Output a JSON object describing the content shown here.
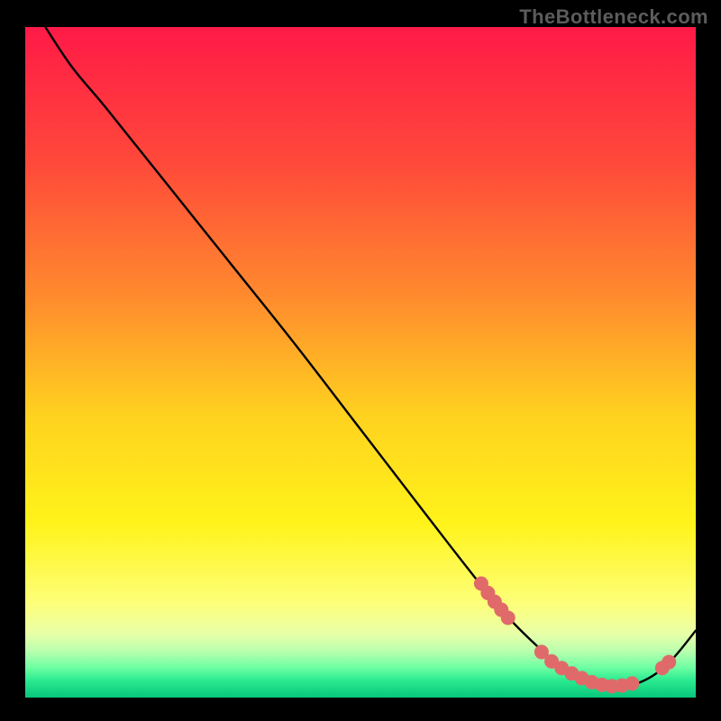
{
  "watermark": "TheBottleneck.com",
  "chart_data": {
    "type": "line",
    "title": "",
    "xlabel": "",
    "ylabel": "",
    "xlim": [
      0,
      100
    ],
    "ylim": [
      0,
      100
    ],
    "background_gradient": {
      "stops": [
        {
          "offset": 0.0,
          "color": "#ff1a47"
        },
        {
          "offset": 0.2,
          "color": "#ff483a"
        },
        {
          "offset": 0.4,
          "color": "#ff8a2e"
        },
        {
          "offset": 0.58,
          "color": "#ffd21f"
        },
        {
          "offset": 0.74,
          "color": "#fff31a"
        },
        {
          "offset": 0.86,
          "color": "#feff7a"
        },
        {
          "offset": 0.905,
          "color": "#e8ffa8"
        },
        {
          "offset": 0.93,
          "color": "#baffae"
        },
        {
          "offset": 0.955,
          "color": "#6fffa3"
        },
        {
          "offset": 0.975,
          "color": "#29e98f"
        },
        {
          "offset": 1.0,
          "color": "#08c67b"
        }
      ]
    },
    "series": [
      {
        "name": "curve",
        "color": "#000000",
        "x": [
          3,
          7,
          12,
          20,
          30,
          40,
          50,
          60,
          67,
          72,
          76,
          80,
          84,
          88,
          92,
          96,
          100
        ],
        "y": [
          100,
          94,
          88,
          78,
          65.5,
          53,
          40,
          27,
          18,
          12,
          8,
          4.5,
          2.4,
          1.7,
          2.4,
          5.2,
          10
        ]
      }
    ],
    "markers": {
      "name": "highlight-dots",
      "color": "#e06a6a",
      "radius_px": 8,
      "points": [
        {
          "x": 68,
          "y": 17.0
        },
        {
          "x": 69,
          "y": 15.6
        },
        {
          "x": 70,
          "y": 14.3
        },
        {
          "x": 71,
          "y": 13.1
        },
        {
          "x": 72,
          "y": 11.9
        },
        {
          "x": 77,
          "y": 6.8
        },
        {
          "x": 78.5,
          "y": 5.4
        },
        {
          "x": 80,
          "y": 4.4
        },
        {
          "x": 81.5,
          "y": 3.6
        },
        {
          "x": 83,
          "y": 2.9
        },
        {
          "x": 84.5,
          "y": 2.3
        },
        {
          "x": 86,
          "y": 1.9
        },
        {
          "x": 87.5,
          "y": 1.7
        },
        {
          "x": 89,
          "y": 1.8
        },
        {
          "x": 90.5,
          "y": 2.1
        },
        {
          "x": 95,
          "y": 4.4
        },
        {
          "x": 96,
          "y": 5.3
        }
      ]
    }
  }
}
